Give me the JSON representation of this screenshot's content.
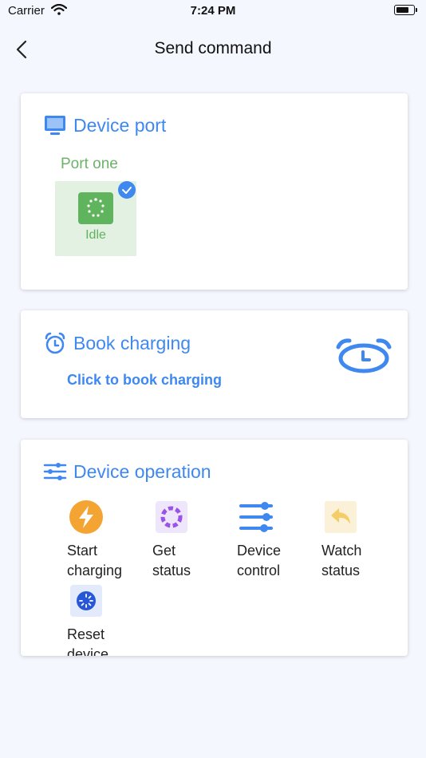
{
  "status_bar": {
    "carrier": "Carrier",
    "time": "7:24 PM"
  },
  "nav": {
    "title": "Send command"
  },
  "device_port": {
    "title": "Device port",
    "port_name": "Port one",
    "port_status": "Idle",
    "selected": true
  },
  "book_charging": {
    "title": "Book charging",
    "link": "Click to book charging"
  },
  "device_operation": {
    "title": "Device operation",
    "items": [
      {
        "label_line1": "Start",
        "label_line2": "charging",
        "icon": "lightning-icon"
      },
      {
        "label_line1": "Get",
        "label_line2": "status",
        "icon": "status-ring-icon"
      },
      {
        "label_line1": "Device",
        "label_line2": "control",
        "icon": "sliders-icon"
      },
      {
        "label_line1": "Watch",
        "label_line2": "status",
        "icon": "reply-arrow-icon"
      },
      {
        "label_line1": "Reset",
        "label_line2": "device",
        "icon": "reset-icon"
      }
    ]
  },
  "colors": {
    "accent": "#3e88f0",
    "idle_green": "#5fb45d",
    "port_label_green": "#6cb36a",
    "orange": "#f3a432",
    "purple": "#9a53e8",
    "yellow": "#f5cd66",
    "background": "#f4f7fd"
  }
}
